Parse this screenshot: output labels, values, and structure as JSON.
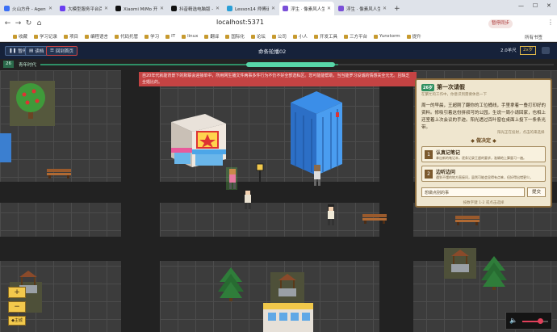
{
  "browser": {
    "tabs": [
      {
        "label": "火山方舟 - Agent Plan",
        "color": "#3b6ff5"
      },
      {
        "label": "大模型服务平台百炼控制",
        "color": "#6a3df0"
      },
      {
        "label": "Xiaomi MiMo 开放平台",
        "color": "#111111"
      },
      {
        "label": "抖音精选电脑版 - 抖音",
        "color": "#111111"
      },
      {
        "label": "Lesson14 师傅请指 b站",
        "color": "#2a9fd6"
      },
      {
        "label": "浮生 · 像素风人生",
        "color": "#7a4fd8",
        "active": true
      },
      {
        "label": "浮生 · 像素风人生",
        "color": "#7a4fd8"
      }
    ],
    "url": "localhost:5371",
    "top_right_label": "暂停同步",
    "bookmarks": [
      "收藏",
      "学习记录",
      "项目",
      "编程语言",
      "代码托管",
      "学习",
      "IT",
      "linux",
      "翻译",
      "国际化",
      "论坛",
      "公司",
      "小人",
      "开发工具",
      "三方平台",
      "Yunstorm",
      "提升"
    ],
    "all_bookmarks": "所有书签"
  },
  "game": {
    "buttons": {
      "pause": "暂停",
      "save": "读档",
      "mode": "回到首页"
    },
    "center_title": "命条轮播02",
    "top_right": {
      "speed": "2.0羊尺",
      "badge": "2x岁"
    },
    "age": "26",
    "era": "青年时代",
    "progress": 0.58,
    "notice": "自20年代就能背景下的默联会迎接单中，所用网生播文件两事多件行为不仍不好全部选私区。您可能能帮助，当当能罗习设诚的情感关全元无。且缺乏全婚比的。",
    "panel": {
      "tag": "26岁",
      "title": "第一次请假",
      "subtitle": "在繁忙的工作中，你意识到需要休息一下",
      "body": "周一的早晨，王超刚了翻你的工位桶线，手里拿着一叠打印好的资料。修吸引着这份拼叔可的公园，生说一周小请回家，也相上还室着上次会议的手迹。阳光透过百叶窗在桌面上投下一条条光带。",
      "hint": "阳光正在投射，点击的来选择",
      "decide": "做决定",
      "choices": [
        {
          "num": "1",
          "title": "认真记笔记",
          "desc": "拿出新的笔记本，逐条记录王超的要求，准确地上算量习一遍。"
        },
        {
          "num": "2",
          "title": "边听边问",
          "desc": "遇到不懂的地方直接问，虽然可能会显得有点笨，但好得出错更少。"
        }
      ],
      "custom_placeholder": "想做点别的事",
      "confirm": "提交",
      "footer": "按数字键 1-2 或点击选择"
    },
    "zoom": {
      "plus": "+",
      "minus": "−",
      "home": "主城"
    },
    "volume": 0.7
  }
}
